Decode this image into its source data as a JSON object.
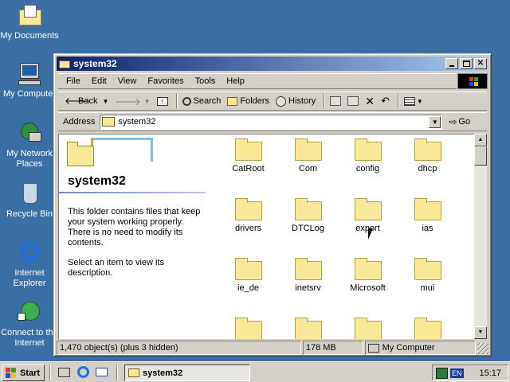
{
  "desktop": {
    "icons": [
      {
        "label": "My Documents",
        "icon": "my-documents-icon"
      },
      {
        "label": "My Computer",
        "icon": "my-computer-icon"
      },
      {
        "label": "My Network Places",
        "icon": "network-places-icon"
      },
      {
        "label": "Recycle Bin",
        "icon": "recycle-bin-icon"
      },
      {
        "label": "Internet Explorer",
        "icon": "internet-explorer-icon"
      },
      {
        "label": "Connect to the Internet",
        "icon": "connect-internet-icon"
      }
    ]
  },
  "window": {
    "title": "system32",
    "menu": [
      "File",
      "Edit",
      "View",
      "Favorites",
      "Tools",
      "Help"
    ],
    "toolbar": {
      "back": "Back",
      "search": "Search",
      "folders": "Folders",
      "history": "History"
    },
    "address": {
      "label": "Address",
      "value": "system32",
      "go": "Go"
    },
    "left_pane": {
      "title": "system32",
      "desc1": "This folder contains files that keep your system working properly. There is no need to modify its contents.",
      "desc2": "Select an item to view its description."
    },
    "folders": [
      "CatRoot",
      "Com",
      "config",
      "dhcp",
      "drivers",
      "DTCLog",
      "export",
      "ias",
      "ie_de",
      "inetsrv",
      "Microsoft",
      "mui",
      "",
      "",
      "",
      ""
    ],
    "status": {
      "objects": "1,470 object(s) (plus 3 hidden)",
      "size": "178 MB",
      "location": "My Computer"
    }
  },
  "taskbar": {
    "start": "Start",
    "task": "system32",
    "lang": "EN",
    "clock": "15:17"
  },
  "colors": {
    "desktop": "#3a6ea5",
    "title_active": "#0a246a",
    "folder": "#f8e898"
  }
}
